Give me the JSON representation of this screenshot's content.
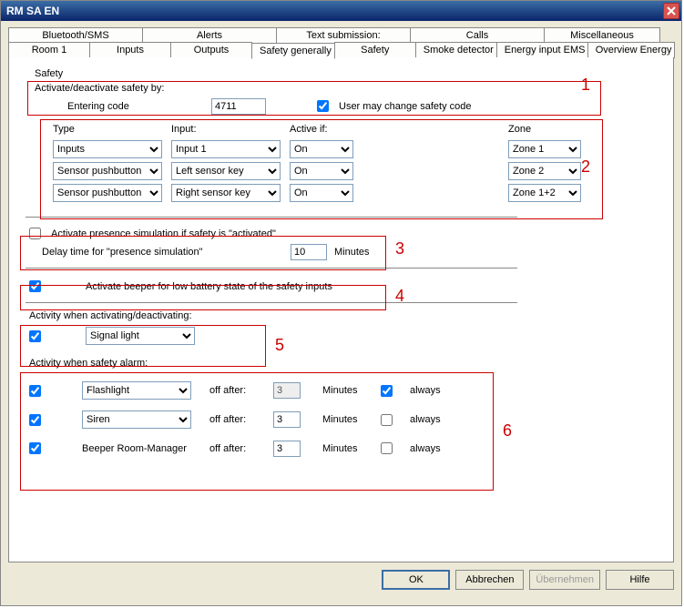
{
  "window": {
    "title": "RM SA EN"
  },
  "tabs_top": [
    "Bluetooth/SMS",
    "Alerts",
    "Text submission:",
    "Calls",
    "Miscellaneous"
  ],
  "tabs_bottom": [
    "Room 1",
    "Inputs",
    "Outputs",
    "Safety generally",
    "Safety",
    "Smoke detector",
    "Energy input EMS",
    "Overview Energy"
  ],
  "active_tab": "Safety generally",
  "safety_header": "Safety",
  "activate": {
    "fieldset": "Activate/deactivate safety by:",
    "code_label": "Entering code",
    "code_value": "4711",
    "user_may_change": "User may change safety code"
  },
  "trigger_table": {
    "headers": {
      "type": "Type",
      "input": "Input:",
      "active": "Active if:",
      "zone": "Zone"
    },
    "rows": [
      {
        "type": "Inputs",
        "input": "Input 1",
        "active": "On",
        "zone": "Zone 1"
      },
      {
        "type": "Sensor pushbutton",
        "input": "Left sensor key",
        "active": "On",
        "zone": "Zone 2"
      },
      {
        "type": "Sensor pushbutton",
        "input": "Right sensor key",
        "active": "On",
        "zone": "Zone 1+2"
      }
    ]
  },
  "presence": {
    "checkbox_label": "Activate presence simulation if safety is \"activated\"",
    "delay_label": "Delay time for \"presence simulation\"",
    "delay_value": "10",
    "delay_unit": "Minutes"
  },
  "battery_beeper": "Activate beeper for low battery state of the safety inputs",
  "activity_activating": {
    "fieldset": "Activity when activating/deactivating:",
    "option": "Signal light"
  },
  "activity_alarm": {
    "fieldset": "Activity when safety alarm:",
    "off_after": "off after:",
    "minutes": "Minutes",
    "always": "always",
    "rows": [
      {
        "label": "Flashlight",
        "dropdown": true,
        "off_val": "3",
        "off_disabled": true,
        "always_checked": true
      },
      {
        "label": "Siren",
        "dropdown": true,
        "off_val": "3",
        "off_disabled": false,
        "always_checked": false
      },
      {
        "label": "Beeper Room-Manager",
        "dropdown": false,
        "off_val": "3",
        "off_disabled": false,
        "always_checked": false
      }
    ]
  },
  "buttons": {
    "ok": "OK",
    "cancel": "Abbrechen",
    "apply": "Übernehmen",
    "help": "Hilfe"
  },
  "annotations": {
    "1": "1",
    "2": "2",
    "3": "3",
    "4": "4",
    "5": "5",
    "6": "6"
  }
}
